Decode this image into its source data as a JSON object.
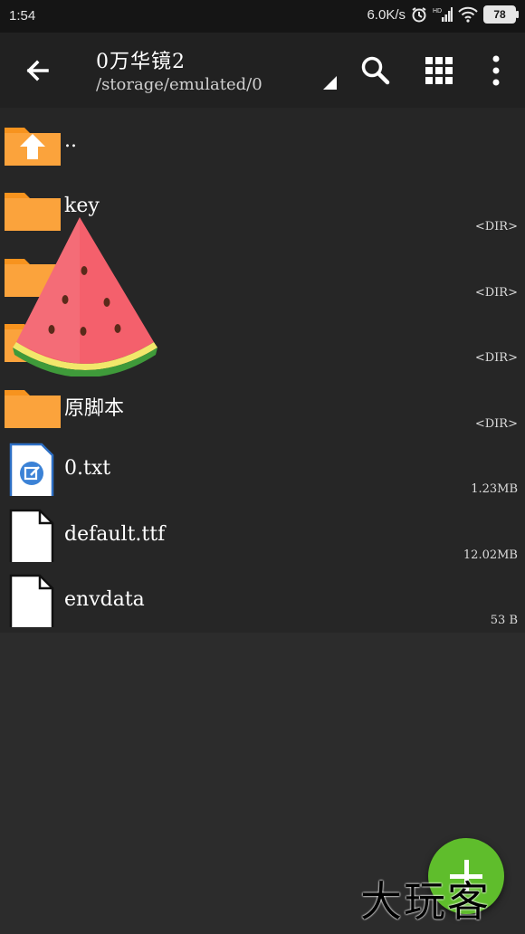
{
  "status_bar": {
    "time": "1:54",
    "net_speed": "6.0K/s",
    "battery": "78",
    "icons": [
      "alarm-icon",
      "hd-signal-icon",
      "wifi-icon",
      "battery-icon"
    ]
  },
  "toolbar": {
    "title": "0万华镜2",
    "path": "/storage/emulated/0",
    "icons": [
      "back-arrow-icon",
      "dropdown-triangle-icon",
      "search-icon",
      "grid-view-icon",
      "more-vert-icon"
    ]
  },
  "files": [
    {
      "name": "..",
      "meta": "",
      "type": "up-folder"
    },
    {
      "name": "key",
      "meta": "<DIR>",
      "type": "folder"
    },
    {
      "name": "",
      "meta": "<DIR>",
      "type": "folder"
    },
    {
      "name": "",
      "meta": "<DIR>",
      "type": "folder"
    },
    {
      "name": "原脚本",
      "meta": "<DIR>",
      "type": "folder"
    },
    {
      "name": "0.txt",
      "meta": "1.23MB",
      "type": "text-file"
    },
    {
      "name": "default.ttf",
      "meta": "12.02MB",
      "type": "file"
    },
    {
      "name": "envdata",
      "meta": "53 B",
      "type": "file"
    }
  ],
  "watermark": "大玩客",
  "colors": {
    "folder": "#f7931e",
    "fab": "#5fbd2c",
    "background": "#2c2c2c",
    "app_bar": "#212121"
  }
}
